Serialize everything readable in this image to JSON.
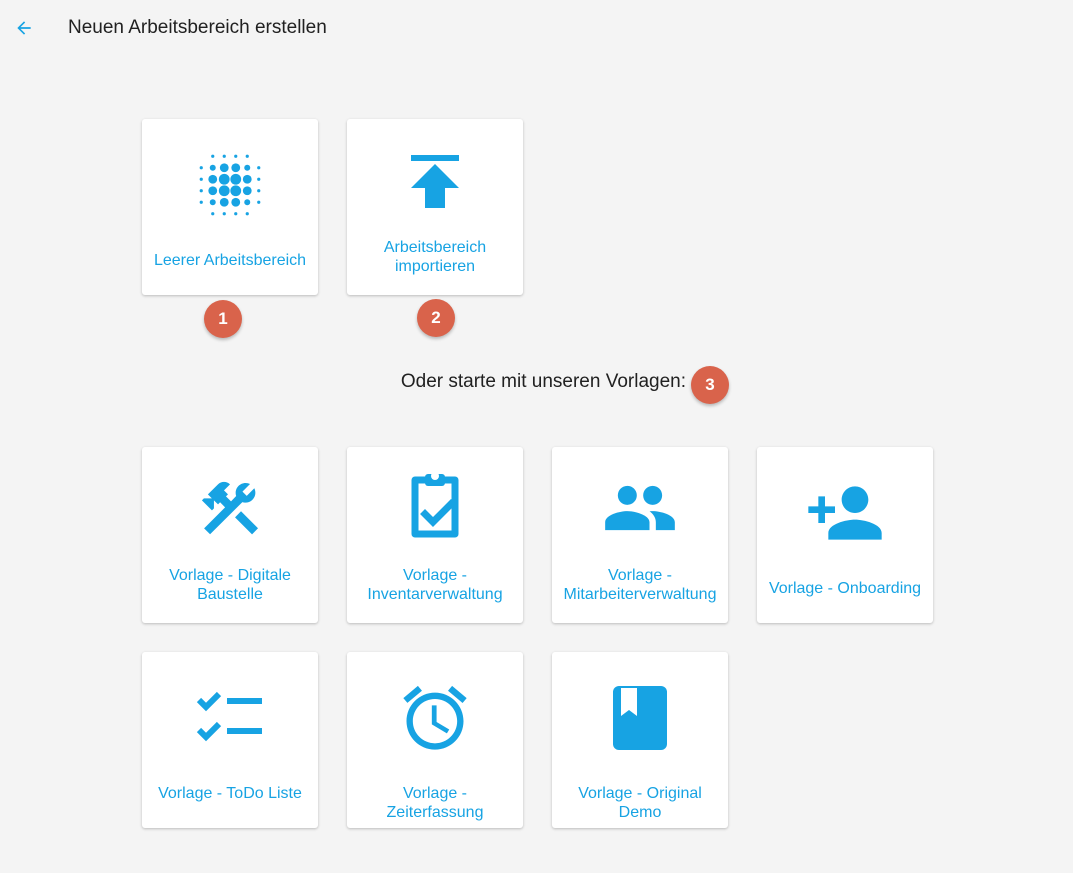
{
  "header": {
    "title": "Neuen Arbeitsbereich erstellen"
  },
  "start_options": [
    {
      "label": "Leerer Arbeitsbereich",
      "icon": "blur-on-icon"
    },
    {
      "label": "Arbeitsbereich importieren",
      "icon": "upload-icon"
    }
  ],
  "templates_heading": "Oder starte mit unseren Vorlagen:",
  "templates": [
    {
      "label": "Vorlage - Digitale Baustelle",
      "icon": "construction-tools-icon"
    },
    {
      "label": "Vorlage - Inventarverwaltung",
      "icon": "assignment-check-icon"
    },
    {
      "label": "Vorlage - Mitarbeiterverwaltung",
      "icon": "people-icon"
    },
    {
      "label": "Vorlage - Onboarding",
      "icon": "person-add-icon"
    },
    {
      "label": "Vorlage - ToDo Liste",
      "icon": "checklist-icon"
    },
    {
      "label": "Vorlage - Zeiterfassung",
      "icon": "alarm-clock-icon"
    },
    {
      "label": "Vorlage - Original Demo",
      "icon": "book-icon"
    }
  ],
  "badges": [
    "1",
    "2",
    "3"
  ],
  "colors": {
    "accent": "#17a3e3",
    "badge": "#d9634b",
    "background": "#f4f4f4"
  }
}
